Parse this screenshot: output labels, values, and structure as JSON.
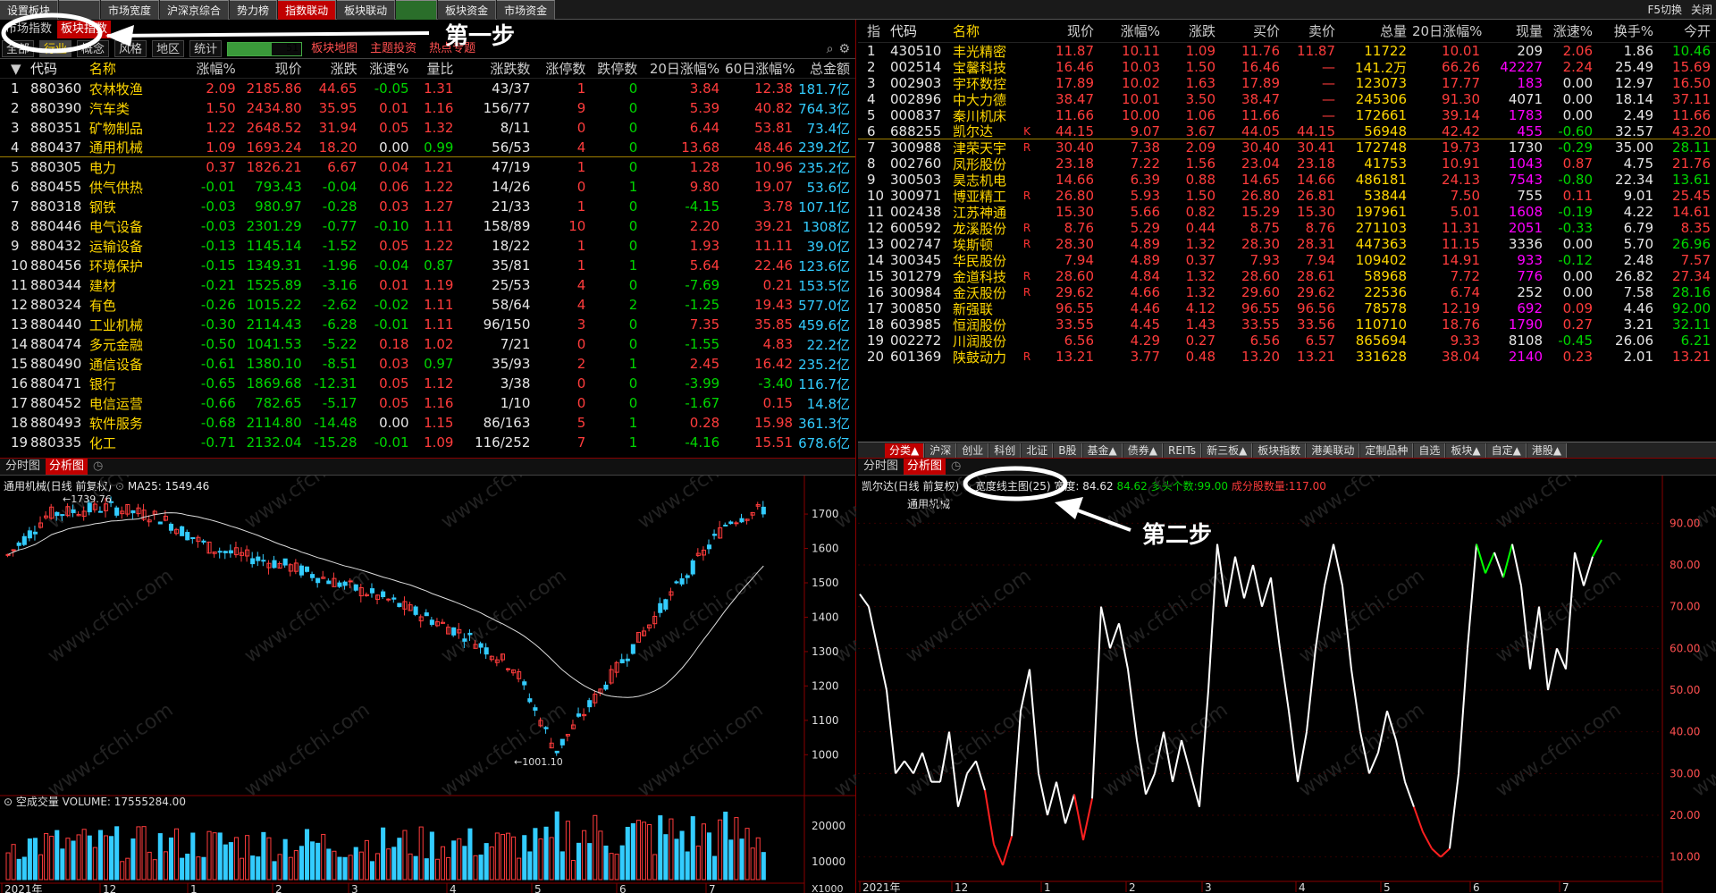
{
  "top_tabs": [
    "设置板块",
    "",
    "市场宽度",
    "沪深京综合",
    "势力榜",
    "指数联动",
    "板块联动",
    "",
    "板块资金",
    "市场资金"
  ],
  "top_active": 5,
  "top_right": {
    "switch": "F5切换",
    "close": "关闭"
  },
  "sub_tabs": [
    "市场指数",
    "板块指数"
  ],
  "filter_tabs": [
    "全部",
    "行业",
    "概念",
    "风格",
    "地区",
    "统计"
  ],
  "page_value": "51",
  "filter_links": [
    "板块地图",
    "主题投资",
    "热点专题"
  ],
  "left_headers": [
    "",
    "代码",
    "名称",
    "涨幅%",
    "现价",
    "涨跌",
    "涨速%",
    "量比",
    "涨跌数",
    "涨停数",
    "跌停数",
    "20日涨幅%",
    "60日涨幅%",
    "总金额"
  ],
  "left_rows": [
    [
      "1",
      "880360",
      "农林牧渔",
      "2.09",
      "2185.86",
      "44.65",
      "-0.05",
      "1.31",
      "43/37",
      "1",
      "0",
      "3.84",
      "12.38",
      "181.7亿"
    ],
    [
      "2",
      "880390",
      "汽车类",
      "1.50",
      "2434.80",
      "35.95",
      "0.01",
      "1.16",
      "156/77",
      "9",
      "0",
      "5.39",
      "40.82",
      "764.3亿"
    ],
    [
      "3",
      "880351",
      "矿物制品",
      "1.22",
      "2648.52",
      "31.94",
      "0.05",
      "1.32",
      "8/11",
      "0",
      "0",
      "6.44",
      "53.81",
      "73.4亿"
    ],
    [
      "4",
      "880437",
      "通用机械",
      "1.09",
      "1693.24",
      "18.20",
      "0.00",
      "0.99",
      "56/53",
      "4",
      "0",
      "13.68",
      "48.46",
      "239.2亿"
    ],
    [
      "5",
      "880305",
      "电力",
      "0.37",
      "1826.21",
      "6.67",
      "0.04",
      "1.21",
      "47/19",
      "1",
      "0",
      "1.28",
      "10.96",
      "235.2亿"
    ],
    [
      "6",
      "880455",
      "供气供热",
      "-0.01",
      "793.43",
      "-0.04",
      "0.06",
      "1.22",
      "14/26",
      "0",
      "1",
      "9.80",
      "19.07",
      "53.6亿"
    ],
    [
      "7",
      "880318",
      "钢铁",
      "-0.03",
      "980.97",
      "-0.28",
      "0.03",
      "1.27",
      "21/33",
      "1",
      "0",
      "-4.15",
      "3.78",
      "107.1亿"
    ],
    [
      "8",
      "880446",
      "电气设备",
      "-0.03",
      "2301.29",
      "-0.77",
      "-0.10",
      "1.11",
      "158/89",
      "10",
      "0",
      "2.20",
      "39.21",
      "1308亿"
    ],
    [
      "9",
      "880432",
      "运输设备",
      "-0.13",
      "1145.14",
      "-1.52",
      "0.05",
      "1.22",
      "18/22",
      "1",
      "0",
      "1.93",
      "11.11",
      "39.0亿"
    ],
    [
      "10",
      "880456",
      "环境保护",
      "-0.15",
      "1349.31",
      "-1.96",
      "-0.04",
      "0.87",
      "35/81",
      "1",
      "1",
      "5.64",
      "22.46",
      "123.6亿"
    ],
    [
      "11",
      "880344",
      "建材",
      "-0.21",
      "1525.89",
      "-3.16",
      "0.01",
      "1.19",
      "25/53",
      "4",
      "0",
      "-7.69",
      "0.21",
      "153.5亿"
    ],
    [
      "12",
      "880324",
      "有色",
      "-0.26",
      "1015.22",
      "-2.62",
      "-0.02",
      "1.11",
      "58/64",
      "4",
      "2",
      "-1.25",
      "19.43",
      "577.0亿"
    ],
    [
      "13",
      "880440",
      "工业机械",
      "-0.30",
      "2114.43",
      "-6.28",
      "-0.01",
      "1.11",
      "96/150",
      "3",
      "0",
      "7.35",
      "35.85",
      "459.6亿"
    ],
    [
      "14",
      "880474",
      "多元金融",
      "-0.50",
      "1041.53",
      "-5.22",
      "0.18",
      "1.02",
      "7/21",
      "0",
      "0",
      "-1.55",
      "4.83",
      "22.2亿"
    ],
    [
      "15",
      "880490",
      "通信设备",
      "-0.61",
      "1380.10",
      "-8.51",
      "0.03",
      "0.97",
      "35/93",
      "2",
      "1",
      "2.45",
      "16.42",
      "235.2亿"
    ],
    [
      "16",
      "880471",
      "银行",
      "-0.65",
      "1869.68",
      "-12.31",
      "0.05",
      "1.12",
      "3/38",
      "0",
      "0",
      "-3.99",
      "-3.40",
      "116.7亿"
    ],
    [
      "17",
      "880452",
      "电信运营",
      "-0.66",
      "782.65",
      "-5.17",
      "0.05",
      "1.16",
      "1/10",
      "0",
      "0",
      "-1.67",
      "0.15",
      "14.8亿"
    ],
    [
      "18",
      "880493",
      "软件服务",
      "-0.68",
      "2114.80",
      "-14.48",
      "0.00",
      "1.15",
      "86/163",
      "5",
      "1",
      "0.28",
      "15.98",
      "361.3亿"
    ],
    [
      "19",
      "880335",
      "化工",
      "-0.71",
      "2132.04",
      "-15.28",
      "-0.01",
      "1.09",
      "116/252",
      "7",
      "1",
      "-4.16",
      "15.51",
      "678.6亿"
    ]
  ],
  "right_headers": [
    "指",
    "代码",
    "名称",
    "",
    "现价",
    "涨幅%",
    "涨跌",
    "买价",
    "卖价",
    "总量",
    "20日涨幅%",
    "现量",
    "涨速%",
    "换手%",
    "今开"
  ],
  "right_rows": [
    [
      "1",
      "430510",
      "丰光精密",
      "",
      "11.87",
      "10.11",
      "1.09",
      "11.76",
      "11.87",
      "11722",
      "10.01",
      "209",
      "2.06",
      "1.86",
      "10.46"
    ],
    [
      "2",
      "002514",
      "宝馨科技",
      "",
      "16.46",
      "10.03",
      "1.50",
      "16.46",
      "—",
      "141.2万",
      "66.26",
      "42227",
      "2.24",
      "25.49",
      "15.69"
    ],
    [
      "3",
      "002903",
      "宇环数控",
      "",
      "17.89",
      "10.02",
      "1.63",
      "17.89",
      "—",
      "123073",
      "17.77",
      "183",
      "0.00",
      "12.97",
      "16.50"
    ],
    [
      "4",
      "002896",
      "中大力德",
      "",
      "38.47",
      "10.01",
      "3.50",
      "38.47",
      "—",
      "245306",
      "91.30",
      "4071",
      "0.00",
      "18.14",
      "37.11"
    ],
    [
      "5",
      "000837",
      "秦川机床",
      "",
      "11.66",
      "10.00",
      "1.06",
      "11.66",
      "—",
      "172661",
      "39.14",
      "1783",
      "0.00",
      "2.49",
      "11.66"
    ],
    [
      "6",
      "688255",
      "凯尔达",
      "K",
      "44.15",
      "9.07",
      "3.67",
      "44.05",
      "44.15",
      "56948",
      "42.42",
      "455",
      "-0.60",
      "32.57",
      "43.20"
    ],
    [
      "7",
      "300988",
      "津荣天宇",
      "R",
      "30.40",
      "7.38",
      "2.09",
      "30.40",
      "30.41",
      "172748",
      "19.73",
      "1730",
      "-0.29",
      "35.00",
      "28.11"
    ],
    [
      "8",
      "002760",
      "凤形股份",
      "",
      "23.18",
      "7.22",
      "1.56",
      "23.04",
      "23.18",
      "41753",
      "10.91",
      "1043",
      "0.87",
      "4.75",
      "21.76"
    ],
    [
      "9",
      "300503",
      "昊志机电",
      "",
      "14.66",
      "6.39",
      "0.88",
      "14.65",
      "14.66",
      "486181",
      "24.13",
      "7543",
      "-0.80",
      "22.34",
      "13.61"
    ],
    [
      "10",
      "300971",
      "博亚精工",
      "R",
      "26.80",
      "5.93",
      "1.50",
      "26.80",
      "26.81",
      "53844",
      "7.50",
      "755",
      "0.11",
      "9.01",
      "25.45"
    ],
    [
      "11",
      "002438",
      "江苏神通",
      "",
      "15.30",
      "5.66",
      "0.82",
      "15.29",
      "15.30",
      "197961",
      "5.01",
      "1608",
      "-0.19",
      "4.22",
      "14.61"
    ],
    [
      "12",
      "600592",
      "龙溪股份",
      "R",
      "8.76",
      "5.29",
      "0.44",
      "8.75",
      "8.76",
      "271103",
      "11.31",
      "2051",
      "-0.33",
      "6.79",
      "8.35"
    ],
    [
      "13",
      "002747",
      "埃斯顿",
      "R",
      "28.30",
      "4.89",
      "1.32",
      "28.30",
      "28.31",
      "447363",
      "11.15",
      "3336",
      "0.00",
      "5.70",
      "26.96"
    ],
    [
      "14",
      "300345",
      "华民股份",
      "",
      "7.94",
      "4.89",
      "0.37",
      "7.93",
      "7.94",
      "109402",
      "14.91",
      "933",
      "-0.12",
      "2.48",
      "7.57"
    ],
    [
      "15",
      "301279",
      "金道科技",
      "R",
      "28.60",
      "4.84",
      "1.32",
      "28.60",
      "28.61",
      "58968",
      "7.72",
      "776",
      "0.00",
      "26.82",
      "27.34"
    ],
    [
      "16",
      "300984",
      "金沃股份",
      "R",
      "29.62",
      "4.66",
      "1.32",
      "29.60",
      "29.62",
      "22536",
      "6.74",
      "252",
      "0.00",
      "7.58",
      "28.16"
    ],
    [
      "17",
      "300850",
      "新强联",
      "",
      "96.55",
      "4.46",
      "4.12",
      "96.55",
      "96.56",
      "78578",
      "12.19",
      "692",
      "0.09",
      "4.46",
      "92.00"
    ],
    [
      "18",
      "603985",
      "恒润股份",
      "",
      "33.55",
      "4.45",
      "1.43",
      "33.55",
      "33.56",
      "110710",
      "18.76",
      "1790",
      "0.27",
      "3.21",
      "32.11"
    ],
    [
      "19",
      "002272",
      "川润股份",
      "",
      "6.56",
      "4.29",
      "0.27",
      "6.56",
      "6.57",
      "865694",
      "9.33",
      "8108",
      "-0.45",
      "26.06",
      "6.21"
    ],
    [
      "20",
      "601369",
      "陕鼓动力",
      "R",
      "13.21",
      "3.77",
      "0.48",
      "13.20",
      "13.21",
      "331628",
      "38.04",
      "2140",
      "0.23",
      "2.01",
      "13.21"
    ]
  ],
  "bottom_tabs": [
    "分类▲",
    "沪深",
    "创业",
    "科创",
    "北证",
    "B股",
    "基金▲",
    "债券▲",
    "REITs",
    "新三板▲",
    "板块指数",
    "港美联动",
    "定制品种",
    "自选",
    "板块▲",
    "自定▲",
    "港股▲"
  ],
  "panel_tabs": [
    "分时图",
    "分析图"
  ],
  "left_chart": {
    "legend_name": "通用机械(日线 前复权)",
    "ma_label": "MA25: 1549.46",
    "high_label": "1739.76",
    "low_label": "1001.10",
    "y_ticks": [
      "1700",
      "1600",
      "1500",
      "1400",
      "1300",
      "1200",
      "1100",
      "1000"
    ],
    "vol_legend": "空成交量 VOLUME: 17555284.00",
    "vol_ticks": [
      "20000",
      "10000"
    ],
    "vol_unit": "X1000",
    "x_labels": [
      "2021年",
      "12",
      "1",
      "2",
      "3",
      "4",
      "5",
      "6",
      "7"
    ]
  },
  "right_chart": {
    "legend_name": "凯尔达(日线 前复权)",
    "indicator": "宽度线主图(25)",
    "width_label": "宽度:",
    "width_val": "84.62",
    "extra1": "84.62",
    "bulls_label": "多头个数:",
    "bulls_val": "99.00",
    "members_label": "成分股数量:",
    "members_val": "117.00",
    "sector_label": "通用机械",
    "y_ticks": [
      "90.00",
      "80.00",
      "70.00",
      "60.00",
      "50.00",
      "40.00",
      "30.00",
      "20.00",
      "10.00"
    ],
    "x_labels": [
      "2021年",
      "12",
      "1",
      "2",
      "3",
      "4",
      "5",
      "6",
      "7"
    ]
  },
  "annotations": {
    "step1": "第一步",
    "step2": "第二步"
  },
  "watermark": "www.cfchi.com"
}
